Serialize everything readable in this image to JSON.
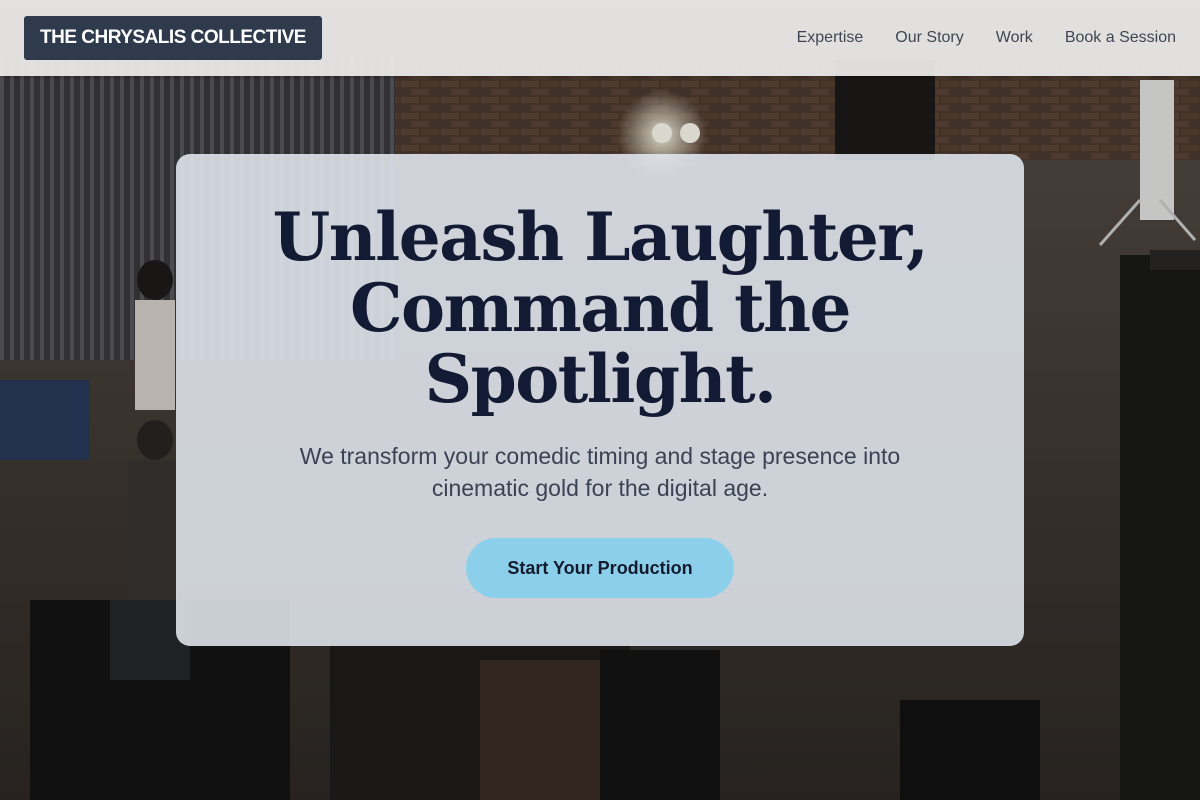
{
  "header": {
    "logo_text": "THE CHRYSALIS COLLECTIVE",
    "nav": [
      {
        "label": "Expertise"
      },
      {
        "label": "Our Story"
      },
      {
        "label": "Work"
      },
      {
        "label": "Book a Session"
      }
    ]
  },
  "hero": {
    "title_line1": "Unleash Laughter,",
    "title_line2": "Command the",
    "title_line3": "Spotlight.",
    "subtitle_line1": "We transform your comedic timing and stage presence into",
    "subtitle_line2": "cinematic gold for the digital age.",
    "cta_label": "Start Your Production"
  },
  "colors": {
    "logo_bg": "#2f3b4c",
    "cta_bg": "#8ccfea",
    "title": "#131a33",
    "card_bg": "#e2e8f0"
  },
  "background": {
    "description_icon": "film-set-photo"
  }
}
